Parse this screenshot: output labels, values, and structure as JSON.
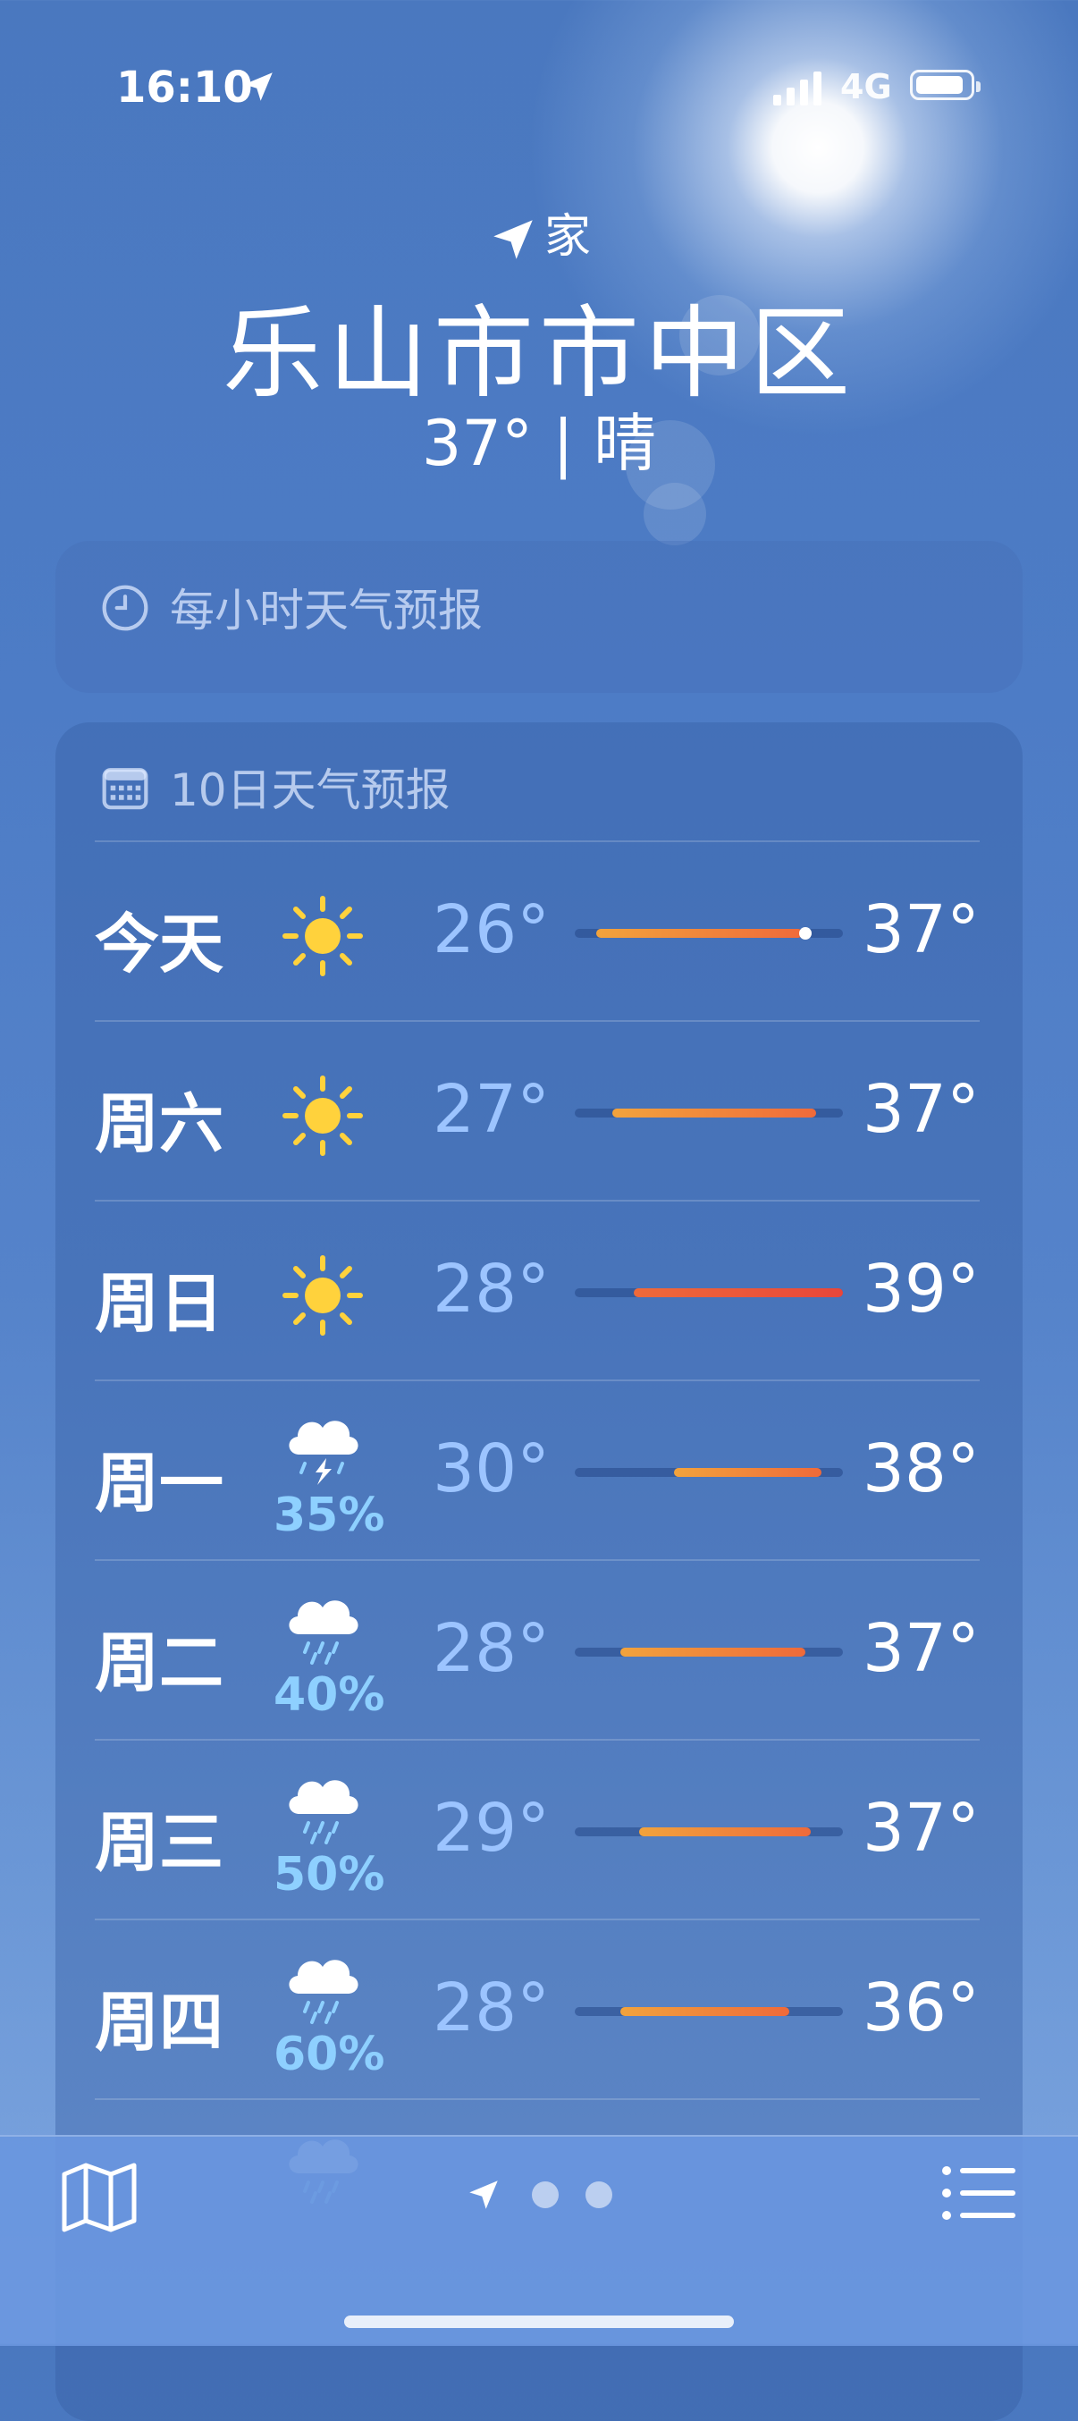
{
  "status_bar": {
    "time": "16:10",
    "network": "4G"
  },
  "header": {
    "location_label": "家",
    "city": "乐山市市中区",
    "current": "37° | 晴"
  },
  "hourly_card": {
    "title": "每小时天气预报"
  },
  "daily_card": {
    "title": "10日天气预报",
    "rows": [
      {
        "day": "今天",
        "icon": "sun-icon",
        "precip": "",
        "low": "26°",
        "high": "37°",
        "bar_start": 0.08,
        "bar_end": 0.85,
        "current_marker": 0.86
      },
      {
        "day": "周六",
        "icon": "sun-icon",
        "precip": "",
        "low": "27°",
        "high": "37°",
        "bar_start": 0.14,
        "bar_end": 0.9
      },
      {
        "day": "周日",
        "icon": "sun-icon",
        "precip": "",
        "low": "28°",
        "high": "39°",
        "bar_start": 0.22,
        "bar_end": 1.0
      },
      {
        "day": "周一",
        "icon": "thunderstorm-icon",
        "precip": "35%",
        "low": "30°",
        "high": "38°",
        "bar_start": 0.37,
        "bar_end": 0.92
      },
      {
        "day": "周二",
        "icon": "rain-cloud-icon",
        "precip": "40%",
        "low": "28°",
        "high": "37°",
        "bar_start": 0.17,
        "bar_end": 0.86
      },
      {
        "day": "周三",
        "icon": "rain-cloud-icon",
        "precip": "50%",
        "low": "29°",
        "high": "37°",
        "bar_start": 0.24,
        "bar_end": 0.88
      },
      {
        "day": "周四",
        "icon": "rain-cloud-icon",
        "precip": "60%",
        "low": "28°",
        "high": "36°",
        "bar_start": 0.17,
        "bar_end": 0.8
      }
    ]
  },
  "colors": {
    "bar_cool": "#f2a33c",
    "bar_warm": "#ef6a3a",
    "bar_hot": "#e8463a",
    "precip": "#8ed0ff"
  },
  "bottom_bar": {
    "icons": [
      "map-icon",
      "location-arrow-icon",
      "page-dot",
      "page-dot",
      "list-icon"
    ]
  }
}
